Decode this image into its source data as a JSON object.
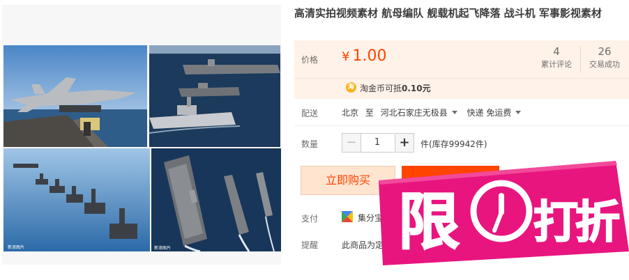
{
  "product": {
    "title": "高清实拍视频素材 航母编队 舰载机起飞降落 战斗机 军事影视素材"
  },
  "price": {
    "label": "价格",
    "currency": "¥",
    "amount": "1.00",
    "reviews_count": "4",
    "reviews_label": "累计评论",
    "trades_count": "26",
    "trades_label": "交易成功",
    "coin_icon_text": "淘",
    "coin_text": "淘金币可抵",
    "coin_value": "0.10元"
  },
  "shipping": {
    "label": "配送",
    "from": "北京",
    "to_word": "至",
    "destination": "河北石家庄无极县",
    "method": "快递 免运费"
  },
  "quantity": {
    "label": "数量",
    "minus": "−",
    "value": "1",
    "plus": "+",
    "stock": "件(库存99942件)"
  },
  "actions": {
    "buy_now": "立即购买"
  },
  "payment": {
    "label": "支付",
    "method": "集分宝"
  },
  "remind": {
    "label": "提醒",
    "text": "此商品为定"
  },
  "promo": {
    "chars": [
      "限",
      "打",
      "折"
    ]
  },
  "watermarks": {
    "photo": "新浪图片"
  },
  "colors": {
    "accent": "#ff4400",
    "price_bg": "#fff2e8",
    "sticker": "#e8157f"
  }
}
